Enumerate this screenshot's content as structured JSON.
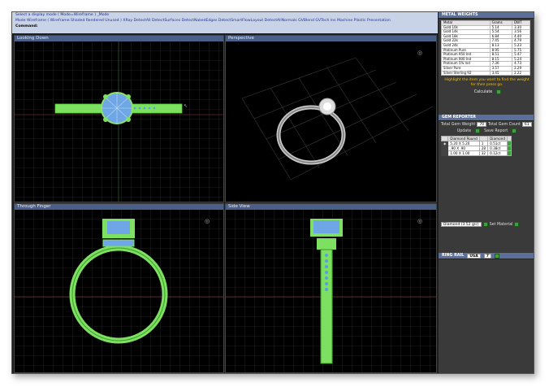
{
  "toolbar": {
    "prompt": "Select a display mode ( Mode=Wireframe ) _Mode",
    "modes": "Mode  Wireframe  ( Wireframe  Shaded  Rendered  Unused )   XRay  DetectAll  DetectSurfaces  DetectNakedEdges  DetectSmartFlowLayout  DetectAllNormals  GVBlend  GVTech  Ins  Machine  Plastic  Presentation",
    "command": "Command:"
  },
  "viewports": {
    "top": "Looking Down",
    "persp": "Perspective",
    "front": "Through Finger",
    "side": "Side View"
  },
  "metal": {
    "title": "METAL WEIGHTS",
    "headers": [
      "Metal",
      "Grams",
      "DWT"
    ],
    "rows": [
      [
        "Gold 10k",
        "5.14",
        "3.30"
      ],
      [
        "Gold 14k",
        "5.54",
        "3.56"
      ],
      [
        "Gold 18k",
        "6.84",
        "4.40"
      ],
      [
        "Gold 22k",
        "7.45",
        "4.79"
      ],
      [
        "Gold 24k",
        "8.13",
        "5.23"
      ],
      [
        "Platinum Pure",
        "8.95",
        "5.75"
      ],
      [
        "Platinum 950 Ind",
        "8.51",
        "5.47"
      ],
      [
        "Platinum 900 Ind",
        "8.15",
        "5.24"
      ],
      [
        "Platinum 5% Ind",
        "7.36",
        "4.73"
      ],
      [
        "Silver Pure",
        "3.57",
        "2.29"
      ],
      [
        "Silver Sterling 92",
        "3.45",
        "2.22"
      ]
    ],
    "highlight": "Highlight the item you want to find the weight for then press go.",
    "calc": "Calculate"
  },
  "gem": {
    "title": "GEM REPORTER",
    "tgw_label": "Total Gem Weight",
    "tgw": "70",
    "tgc_label": "Total Gem Count",
    "tgc": "61",
    "update": "Update",
    "save": "Save Report",
    "headers": [
      "Diamond Round",
      "",
      "Diamond"
    ],
    "rows": [
      [
        "5.20 X 5.20",
        "1",
        "0.51ct"
      ],
      [
        ".90 X .90",
        "28",
        "0.38ct"
      ],
      [
        "1.00 X 1.00",
        "32",
        "0.12ct"
      ]
    ],
    "material_sel": "Diamond  (3.52 g/c)",
    "set_mat": "Set Material"
  },
  "ring": {
    "title": "RING RAIL",
    "size_unit": "USA",
    "size": "7"
  }
}
